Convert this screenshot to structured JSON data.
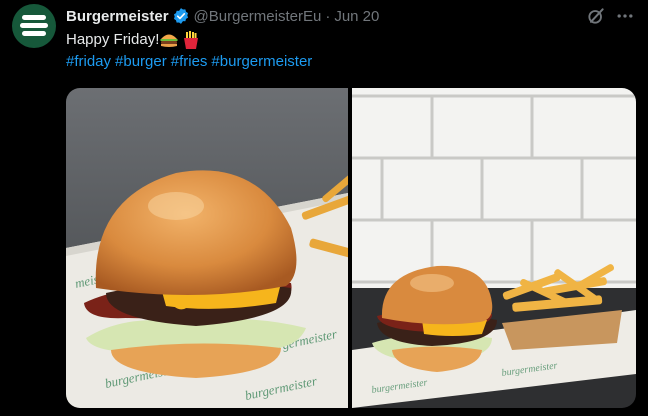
{
  "tweet": {
    "author_name": "Burgermeister",
    "handle": "@BurgermeisterEu",
    "separator": "·",
    "date": "Jun 20",
    "text": "Happy Friday!",
    "hashtags": [
      "#friday",
      "#burger",
      "#fries",
      "#burgermeister"
    ]
  },
  "icons": {
    "verified": "verified-badge-icon",
    "grok": "grok-icon",
    "more": "more-options-icon",
    "emoji_1": "burger-emoji",
    "emoji_2": "fries-emoji"
  },
  "colors": {
    "background": "#000000",
    "text": "#e7e9ea",
    "muted": "#71767b",
    "link": "#1d9bf0",
    "verified": "#1d9bf0",
    "avatar": "#16583a"
  }
}
